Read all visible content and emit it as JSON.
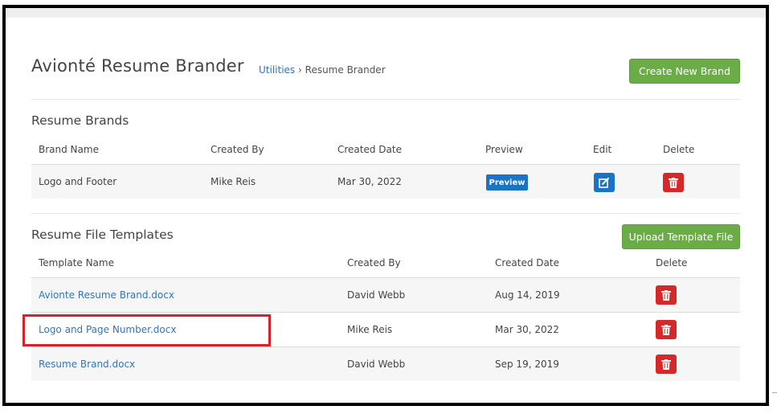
{
  "page": {
    "title": "Avionté Resume Brander",
    "breadcrumb": {
      "parent": "Utilities",
      "separator": "›",
      "current": "Resume Brander"
    },
    "create_button": "Create New Brand"
  },
  "brands": {
    "title": "Resume Brands",
    "headers": [
      "Brand Name",
      "Created By",
      "Created Date",
      "Preview",
      "Edit",
      "Delete"
    ],
    "rows": [
      {
        "name": "Logo and Footer",
        "created_by": "Mike Reis",
        "created_date": "Mar 30, 2022",
        "preview_label": "Preview"
      }
    ]
  },
  "templates": {
    "title": "Resume File Templates",
    "upload_button": "Upload Template File",
    "headers": [
      "Template Name",
      "Created By",
      "Created Date",
      "Delete"
    ],
    "rows": [
      {
        "name": "Avionte Resume Brand.docx",
        "created_by": "David Webb",
        "created_date": "Aug 14, 2019"
      },
      {
        "name": "Logo and Page Number.docx",
        "created_by": "Mike Reis",
        "created_date": "Mar 30, 2022"
      },
      {
        "name": "Resume Brand.docx",
        "created_by": "David Webb",
        "created_date": "Sep 19, 2019"
      }
    ]
  },
  "colors": {
    "accent_green": "#6aac45",
    "link_blue": "#3475b7",
    "action_blue": "#1a73c4",
    "delete_red": "#d62828",
    "highlight_red": "#d6232a"
  },
  "icons": {
    "edit": "edit-icon",
    "delete": "trash-icon"
  }
}
